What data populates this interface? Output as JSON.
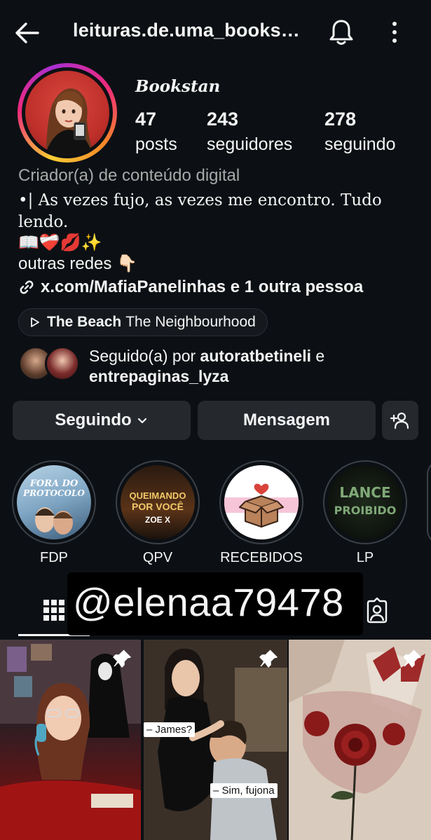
{
  "header": {
    "username": "leituras.de.uma_books…"
  },
  "profile": {
    "display_name": "Bookstan",
    "stats": [
      {
        "value": "47",
        "label": "posts"
      },
      {
        "value": "243",
        "label": "seguidores"
      },
      {
        "value": "278",
        "label": "seguindo"
      }
    ],
    "category": "Criador(a) de conteúdo digital",
    "bio_line1": "•| As vezes fujo, as vezes me encontro. Tudo lendo.",
    "bio_emojis": "📖❤️‍🩹💋✨",
    "bio_other": "outras redes 👇🏻",
    "link_text": "x.com/MafiaPanelinhas e 1 outra pessoa",
    "music_title": "The Beach",
    "music_artist": "The Neighbourhood",
    "followed_prefix": "Seguido(a) por ",
    "followed_user1": "autoratbetineli",
    "followed_joiner": " e",
    "followed_user2": "entrepaginas_lyza"
  },
  "actions": {
    "follow_label": "Seguindo",
    "message_label": "Mensagem"
  },
  "highlights": [
    {
      "name": "FDP",
      "cover_text": "FORA DO PROTOCOLO"
    },
    {
      "name": "QPV",
      "cover_text": "QUEIMANDO POR VOCÊ",
      "cover_sub": "ZOE X"
    },
    {
      "name": "RECEBIDOS"
    },
    {
      "name": "LP",
      "cover_text": "LANCE PROIBIDO"
    }
  ],
  "watermark": "@elenaa79478",
  "posts": [
    {
      "caption": ""
    },
    {
      "caption1": "– James?",
      "caption2": "– Sim, fujona"
    },
    {
      "caption": ""
    }
  ],
  "colors": {
    "background": "#0c1014",
    "button": "#25292e",
    "muted_text": "#a8a8a8"
  },
  "icons": [
    "back-arrow-icon",
    "bell-icon",
    "more-vertical-icon",
    "link-icon",
    "play-icon",
    "chevron-down-icon",
    "add-person-icon",
    "grid-icon",
    "tagged-icon",
    "pin-icon"
  ]
}
